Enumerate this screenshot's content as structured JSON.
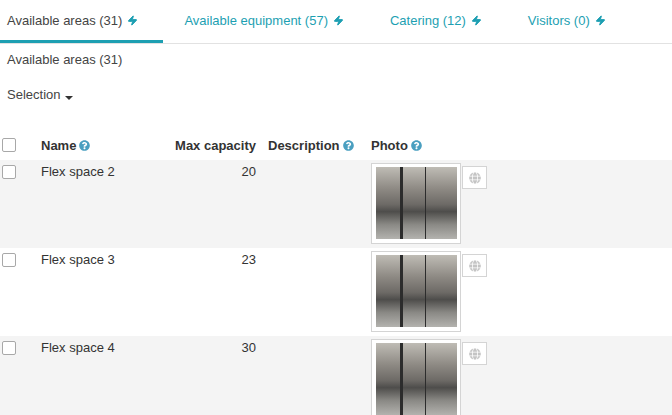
{
  "tabs": [
    {
      "label": "Available areas (31)",
      "selected": true
    },
    {
      "label": "Available equipment (57)",
      "selected": false
    },
    {
      "label": "Catering (12)",
      "selected": false
    },
    {
      "label": "Visitors (0)",
      "selected": false
    }
  ],
  "section": {
    "title": "Available areas (31)",
    "selection_menu": "Selection"
  },
  "table": {
    "all_checked": false,
    "columns": [
      {
        "label": "Name",
        "help": true,
        "align": "left"
      },
      {
        "label": "Max capacity",
        "help": false,
        "align": "right"
      },
      {
        "label": "Description",
        "help": true,
        "align": "left"
      },
      {
        "label": "Photo",
        "help": true,
        "align": "left"
      }
    ],
    "rows": [
      {
        "name": "Flex space 2",
        "max_capacity": "20",
        "description": "",
        "checked": false
      },
      {
        "name": "Flex space 3",
        "max_capacity": "23",
        "description": "",
        "checked": false
      },
      {
        "name": "Flex space 4",
        "max_capacity": "30",
        "description": "",
        "checked": false
      }
    ]
  }
}
